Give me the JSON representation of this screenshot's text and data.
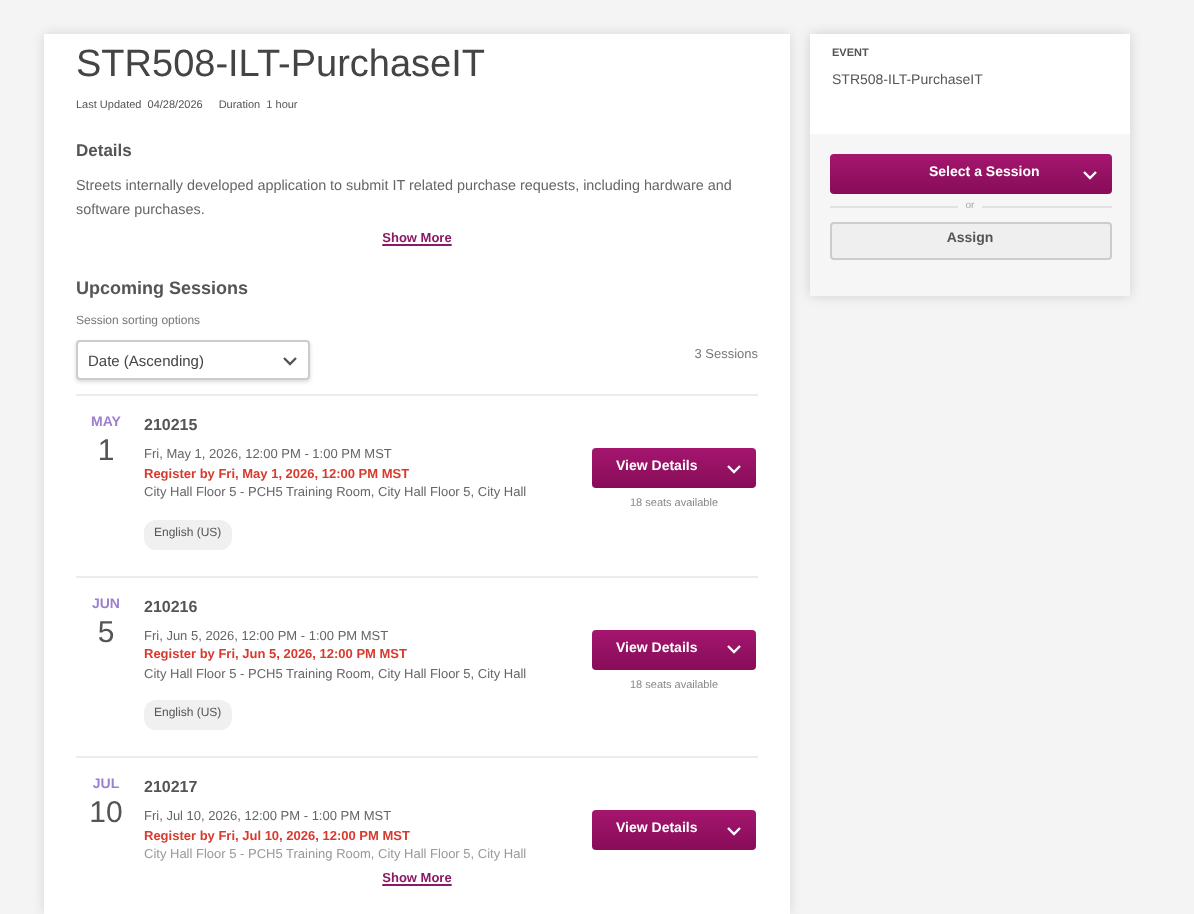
{
  "course": {
    "title": "STR508-ILT-PurchaseIT",
    "meta": [
      {
        "label": "Last Updated",
        "value": "04/28/2026"
      },
      {
        "label": "Duration",
        "value": "1 hour"
      }
    ],
    "details_heading": "Details",
    "description": "Streets internally developed application to submit IT related purchase requests, including hardware and software purchases.",
    "show_more": "Show More"
  },
  "sessions_section": {
    "heading": "Upcoming Sessions",
    "sort_label": "Session sorting options",
    "sort_value": "Date (Ascending)",
    "count": "3 Sessions",
    "show_more": "Show More",
    "sessions": [
      {
        "month": "MAY",
        "day": "1",
        "id": "210215",
        "time": "Fri, May 1, 2026, 12:00 PM - 1:00 PM MST",
        "register_by": "Register by Fri, May 1, 2026, 12:00 PM MST",
        "location": "City Hall Floor 5 - PCH5 Training Room, City Hall Floor 5, City Hall",
        "language": "English (US)",
        "button": "View Details",
        "seats": "18 seats available"
      },
      {
        "month": "JUN",
        "day": "5",
        "id": "210216",
        "time": "Fri, Jun 5, 2026, 12:00 PM - 1:00 PM MST",
        "register_by": "Register by Fri, Jun 5, 2026, 12:00 PM MST",
        "location": "City Hall Floor 5 - PCH5 Training Room, City Hall Floor 5, City Hall",
        "language": "English (US)",
        "button": "View Details",
        "seats": "18 seats available"
      },
      {
        "month": "JUL",
        "day": "10",
        "id": "210217",
        "time": "Fri, Jul 10, 2026, 12:00 PM - 1:00 PM MST",
        "register_by": "Register by Fri, Jul 10, 2026, 12:00 PM MST",
        "location": "City Hall Floor 5 - PCH5 Training Room, City Hall Floor 5, City Hall",
        "button": "View Details"
      }
    ]
  },
  "event_panel": {
    "label": "EVENT",
    "name": "STR508-ILT-PurchaseIT",
    "select_button": "Select a Session",
    "or": "or",
    "assign_button": "Assign"
  }
}
